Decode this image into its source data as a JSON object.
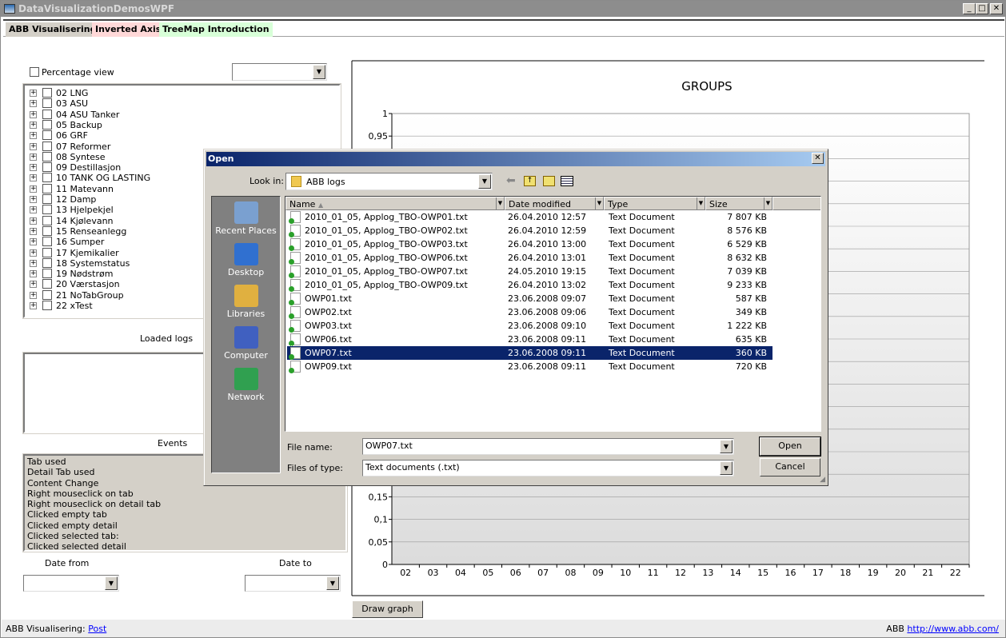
{
  "window": {
    "title": "DataVisualizationDemosWPF",
    "controls": [
      "_",
      "□",
      "✕"
    ]
  },
  "tabs": [
    {
      "label": "ABB Visualisering",
      "color": "#d4d0c8"
    },
    {
      "label": "Inverted Axis",
      "color": "#ffd8d8"
    },
    {
      "label": "TreeMap Introduction",
      "color": "#d8ffd8"
    }
  ],
  "left": {
    "percentage_view": "Percentage view",
    "groups": [
      "02 LNG",
      "03 ASU",
      "04 ASU Tanker",
      "05 Backup",
      "06 GRF",
      "07 Reformer",
      "08 Syntese",
      "09 Destillasjon",
      "10 TANK OG LASTING",
      "11 Matevann",
      "12 Damp",
      "13 Hjelpekjel",
      "14 Kjølevann",
      "15 Renseanlegg",
      "16 Sumper",
      "17 Kjemikalier",
      "18 Systemstatus",
      "19 Nødstrøm",
      "20 Værstasjon",
      "21 NoTabGroup",
      "22 xTest"
    ],
    "loaded_logs": "Loaded logs",
    "events_label": "Events",
    "events": [
      "Tab used",
      "Detail Tab used",
      "Content Change",
      "Right mouseclick on tab",
      "Right mouseclick on detail tab",
      "Clicked empty tab",
      "Clicked empty detail",
      "Clicked selected tab:",
      "Clicked selected detail"
    ],
    "date_from": "Date from",
    "date_to": "Date to"
  },
  "chart_data": {
    "type": "bar",
    "title": "GROUPS",
    "categories": [
      "02",
      "03",
      "04",
      "05",
      "06",
      "07",
      "08",
      "09",
      "10",
      "11",
      "12",
      "13",
      "14",
      "15",
      "16",
      "17",
      "18",
      "19",
      "20",
      "21",
      "22"
    ],
    "values": [],
    "ylim": [
      0,
      1
    ],
    "yticks": [
      "0",
      "0,05",
      "0,1",
      "0,15",
      "0,95",
      "1"
    ],
    "grid": true
  },
  "draw_graph": "Draw graph",
  "footer": {
    "left_label": "ABB Visualisering:",
    "left_link": "Post",
    "right_label": "ABB",
    "right_link": "http://www.abb.com/"
  },
  "dialog": {
    "title": "Open",
    "look_in_label": "Look in:",
    "look_in_value": "ABB logs",
    "places": [
      "Recent Places",
      "Desktop",
      "Libraries",
      "Computer",
      "Network"
    ],
    "columns": [
      "Name",
      "Date modified",
      "Type",
      "Size"
    ],
    "files": [
      {
        "name": "2010_01_05, Applog_TBO-OWP01.txt",
        "date": "26.04.2010 12:57",
        "type": "Text Document",
        "size": "7 807 KB"
      },
      {
        "name": "2010_01_05, Applog_TBO-OWP02.txt",
        "date": "26.04.2010 12:59",
        "type": "Text Document",
        "size": "8 576 KB"
      },
      {
        "name": "2010_01_05, Applog_TBO-OWP03.txt",
        "date": "26.04.2010 13:00",
        "type": "Text Document",
        "size": "6 529 KB"
      },
      {
        "name": "2010_01_05, Applog_TBO-OWP06.txt",
        "date": "26.04.2010 13:01",
        "type": "Text Document",
        "size": "8 632 KB"
      },
      {
        "name": "2010_01_05, Applog_TBO-OWP07.txt",
        "date": "24.05.2010 19:15",
        "type": "Text Document",
        "size": "7 039 KB"
      },
      {
        "name": "2010_01_05, Applog_TBO-OWP09.txt",
        "date": "26.04.2010 13:02",
        "type": "Text Document",
        "size": "9 233 KB"
      },
      {
        "name": "OWP01.txt",
        "date": "23.06.2008 09:07",
        "type": "Text Document",
        "size": "587 KB"
      },
      {
        "name": "OWP02.txt",
        "date": "23.06.2008 09:06",
        "type": "Text Document",
        "size": "349 KB"
      },
      {
        "name": "OWP03.txt",
        "date": "23.06.2008 09:10",
        "type": "Text Document",
        "size": "1 222 KB"
      },
      {
        "name": "OWP06.txt",
        "date": "23.06.2008 09:11",
        "type": "Text Document",
        "size": "635 KB"
      },
      {
        "name": "OWP07.txt",
        "date": "23.06.2008 09:11",
        "type": "Text Document",
        "size": "360 KB",
        "selected": true
      },
      {
        "name": "OWP09.txt",
        "date": "23.06.2008 09:11",
        "type": "Text Document",
        "size": "720 KB"
      }
    ],
    "file_name_label": "File name:",
    "file_name_value": "OWP07.txt",
    "file_type_label": "Files of type:",
    "file_type_value": "Text documents (.txt)",
    "open": "Open",
    "cancel": "Cancel"
  }
}
